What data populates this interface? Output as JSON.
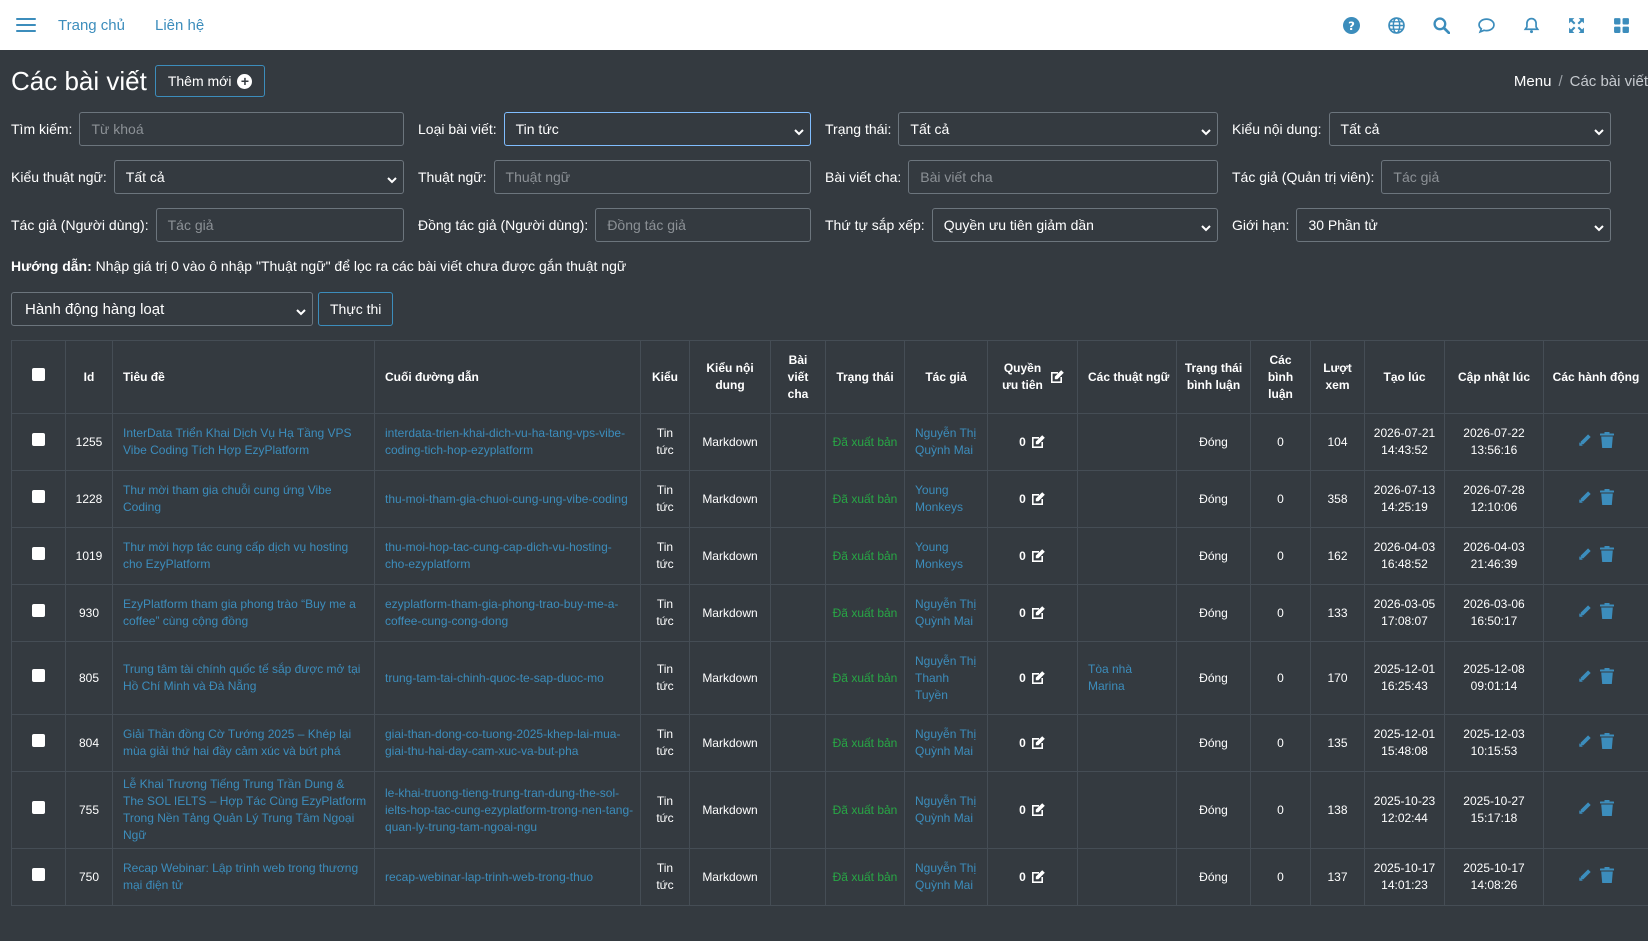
{
  "topbar": {
    "home": "Trang chủ",
    "contact": "Liên hệ",
    "icons": [
      "question-circle",
      "globe",
      "search",
      "comments",
      "bell",
      "expand",
      "th-large"
    ]
  },
  "page": {
    "title": "Các bài viết",
    "add_button": "Thêm mới",
    "breadcrumb": {
      "menu": "Menu",
      "current": "Các bài viết"
    }
  },
  "filters": {
    "search": {
      "label": "Tìm kiếm:",
      "placeholder": "Từ khoá"
    },
    "post_type": {
      "label": "Loại bài viết:",
      "value": "Tin tức"
    },
    "status": {
      "label": "Trạng thái:",
      "value": "Tất cả"
    },
    "content_type": {
      "label": "Kiểu nội dung:",
      "value": "Tất cả"
    },
    "term_type": {
      "label": "Kiểu thuật ngữ:",
      "value": "Tất cả"
    },
    "term": {
      "label": "Thuật ngữ:",
      "placeholder": "Thuật ngữ"
    },
    "parent": {
      "label": "Bài viết cha:",
      "placeholder": "Bài viết cha"
    },
    "author_admin": {
      "label": "Tác giả (Quản trị viên):",
      "placeholder": "Tác giả"
    },
    "author_user": {
      "label": "Tác giả (Người dùng):",
      "placeholder": "Tác giả"
    },
    "coauthor": {
      "label": "Đồng tác giả (Người dùng):",
      "placeholder": "Đồng tác giả"
    },
    "sort": {
      "label": "Thứ tự sắp xếp:",
      "value": "Quyền ưu tiên giảm dần"
    },
    "limit": {
      "label": "Giới hạn:",
      "value": "30 Phần tử"
    }
  },
  "hint": {
    "bold": "Hướng dẫn:",
    "text": " Nhập giá trị 0 vào ô nhập \"Thuật ngữ\" để lọc ra các bài viết chưa được gắn thuật ngữ"
  },
  "bulk": {
    "value": "Hành động hàng loạt",
    "run": "Thực thi"
  },
  "table": {
    "headers": {
      "id": "Id",
      "title": "Tiêu đề",
      "slug": "Cuối đường dẫn",
      "type": "Kiểu",
      "content_type": "Kiểu nội dung",
      "parent": "Bài viết cha",
      "status": "Trạng thái",
      "author": "Tác giả",
      "priority": "Quyền ưu tiên",
      "terms": "Các thuật ngữ",
      "comment_status": "Trạng thái bình luận",
      "comments": "Các bình luận",
      "views": "Lượt xem",
      "created": "Tạo lúc",
      "updated": "Cập nhật lúc",
      "actions": "Các hành động"
    },
    "rows": [
      {
        "id": "1255",
        "title": "InterData Triển Khai Dịch Vụ Hạ Tầng VPS Vibe Coding Tích Hợp EzyPlatform",
        "slug": "interdata-trien-khai-dich-vu-ha-tang-vps-vibe-coding-tich-hop-ezyplatform",
        "type": "Tin tức",
        "content_type": "Markdown",
        "parent": "",
        "status": "Đã xuất bản",
        "author": "Nguyễn Thị Quỳnh Mai",
        "priority": "0",
        "terms": "",
        "comment_status": "Đóng",
        "comments": "0",
        "views": "104",
        "created_date": "2026-07-21",
        "created_time": "14:43:52",
        "updated_date": "2026-07-22",
        "updated_time": "13:56:16"
      },
      {
        "id": "1228",
        "title": "Thư mời tham gia chuỗi cung ứng Vibe Coding",
        "slug": "thu-moi-tham-gia-chuoi-cung-ung-vibe-coding",
        "type": "Tin tức",
        "content_type": "Markdown",
        "parent": "",
        "status": "Đã xuất bản",
        "author": "Young Monkeys",
        "priority": "0",
        "terms": "",
        "comment_status": "Đóng",
        "comments": "0",
        "views": "358",
        "created_date": "2026-07-13",
        "created_time": "14:25:19",
        "updated_date": "2026-07-28",
        "updated_time": "12:10:06"
      },
      {
        "id": "1019",
        "title": "Thư mời hợp tác cung cấp dịch vụ hosting cho EzyPlatform",
        "slug": "thu-moi-hop-tac-cung-cap-dich-vu-hosting-cho-ezyplatform",
        "type": "Tin tức",
        "content_type": "Markdown",
        "parent": "",
        "status": "Đã xuất bản",
        "author": "Young Monkeys",
        "priority": "0",
        "terms": "",
        "comment_status": "Đóng",
        "comments": "0",
        "views": "162",
        "created_date": "2026-04-03",
        "created_time": "16:48:52",
        "updated_date": "2026-04-03",
        "updated_time": "21:46:39"
      },
      {
        "id": "930",
        "title": "EzyPlatform tham gia phong trào “Buy me a coffee” cùng cộng đồng",
        "slug": "ezyplatform-tham-gia-phong-trao-buy-me-a-coffee-cung-cong-dong",
        "type": "Tin tức",
        "content_type": "Markdown",
        "parent": "",
        "status": "Đã xuất bản",
        "author": "Nguyễn Thị Quỳnh Mai",
        "priority": "0",
        "terms": "",
        "comment_status": "Đóng",
        "comments": "0",
        "views": "133",
        "created_date": "2026-03-05",
        "created_time": "17:08:07",
        "updated_date": "2026-03-06",
        "updated_time": "16:50:17"
      },
      {
        "id": "805",
        "title": "Trung tâm tài chính quốc tế sắp được mở tại Hồ Chí Minh và Đà Nẵng",
        "slug": "trung-tam-tai-chinh-quoc-te-sap-duoc-mo",
        "type": "Tin tức",
        "content_type": "Markdown",
        "parent": "",
        "status": "Đã xuất bản",
        "author": "Nguyễn Thị Thanh Tuyền",
        "priority": "0",
        "terms": "Tòa nhà Marina",
        "comment_status": "Đóng",
        "comments": "0",
        "views": "170",
        "created_date": "2025-12-01",
        "created_time": "16:25:43",
        "updated_date": "2025-12-08",
        "updated_time": "09:01:14"
      },
      {
        "id": "804",
        "title": "Giải Thần đồng Cờ Tướng 2025 – Khép lại mùa giải thứ hai đầy cảm xúc và bứt phá",
        "slug": "giai-than-dong-co-tuong-2025-khep-lai-mua-giai-thu-hai-day-cam-xuc-va-but-pha",
        "type": "Tin tức",
        "content_type": "Markdown",
        "parent": "",
        "status": "Đã xuất bản",
        "author": "Nguyễn Thị Quỳnh Mai",
        "priority": "0",
        "terms": "",
        "comment_status": "Đóng",
        "comments": "0",
        "views": "135",
        "created_date": "2025-12-01",
        "created_time": "15:48:08",
        "updated_date": "2025-12-03",
        "updated_time": "10:15:53"
      },
      {
        "id": "755",
        "title": "Lễ Khai Trương Tiếng Trung Trần Dung & The SOL IELTS – Hợp Tác Cùng EzyPlatform Trong Nền Tảng Quản Lý Trung Tâm Ngoại Ngữ",
        "slug": "le-khai-truong-tieng-trung-tran-dung-the-sol-ielts-hop-tac-cung-ezyplatform-trong-nen-tang-quan-ly-trung-tam-ngoai-ngu",
        "type": "Tin tức",
        "content_type": "Markdown",
        "parent": "",
        "status": "Đã xuất bản",
        "author": "Nguyễn Thị Quỳnh Mai",
        "priority": "0",
        "terms": "",
        "comment_status": "Đóng",
        "comments": "0",
        "views": "138",
        "created_date": "2025-10-23",
        "created_time": "12:02:44",
        "updated_date": "2025-10-27",
        "updated_time": "15:17:18"
      },
      {
        "id": "750",
        "title": "Recap Webinar: Lập trình web trong thương mại điện tử",
        "slug": "recap-webinar-lap-trinh-web-trong-thuo",
        "type": "Tin tức",
        "content_type": "Markdown",
        "parent": "",
        "status": "Đã xuất bản",
        "author": "Nguyễn Thị Quỳnh Mai",
        "priority": "0",
        "terms": "",
        "comment_status": "Đóng",
        "comments": "0",
        "views": "137",
        "created_date": "2025-10-17",
        "created_time": "14:01:23",
        "updated_date": "2025-10-17",
        "updated_time": "14:08:26"
      }
    ]
  },
  "colors": {
    "background": "#343a40",
    "link": "#3c8dbc",
    "published": "#28a745",
    "topbar": "#ffffff"
  }
}
